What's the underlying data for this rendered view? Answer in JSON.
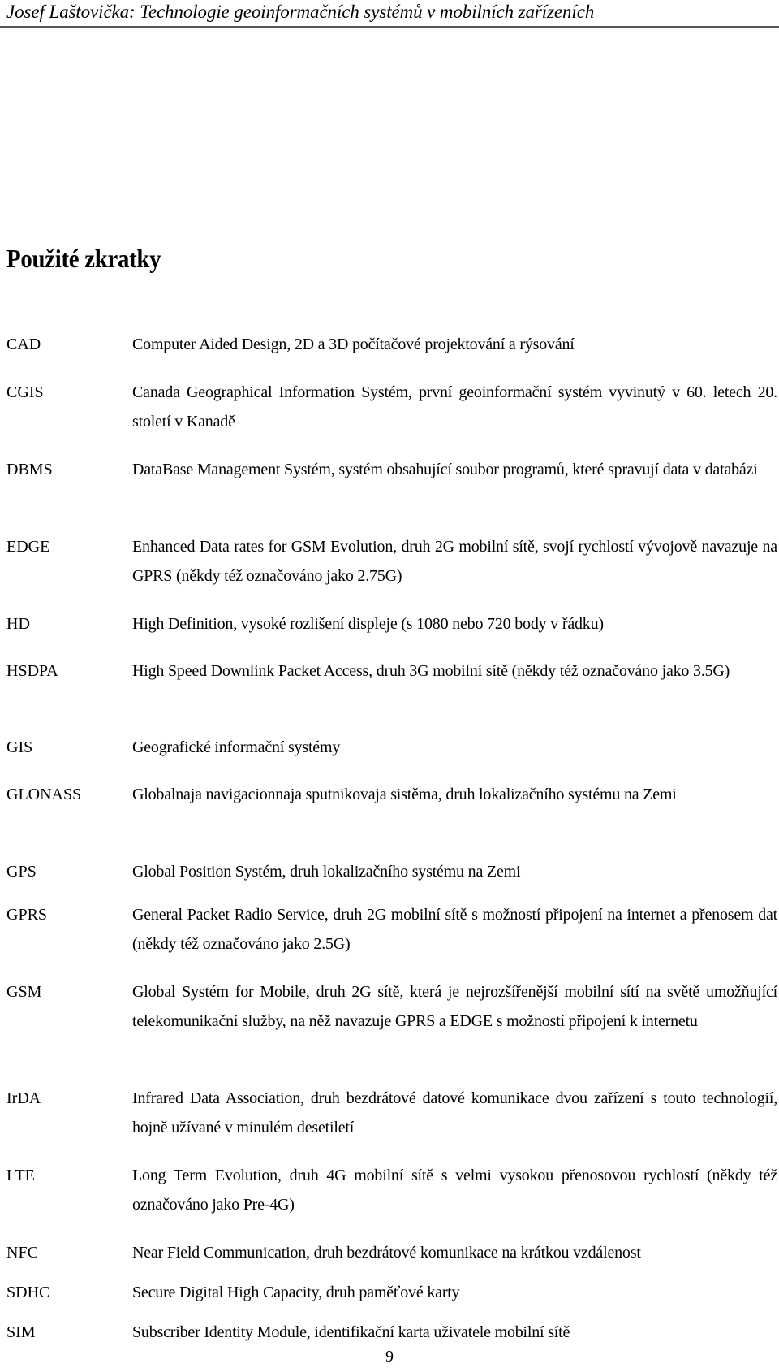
{
  "header": {
    "running_title": "Josef Laštovička: Technologie geoinformačních systémů v mobilních zařízeních"
  },
  "page_title": "Použité zkratky",
  "abbreviations": [
    {
      "term": "CAD",
      "definition": "Computer Aided Design, 2D a 3D počítačové projektování a rýsování"
    },
    {
      "term": "CGIS",
      "definition": "Canada Geographical Information Systém, první geoinformační systém vyvinutý v 60. letech 20. století v Kanadě"
    },
    {
      "term": "DBMS",
      "definition": "DataBase Management Systém, systém obsahující soubor programů, které spravují data v databázi"
    },
    {
      "term": "EDGE",
      "definition": "Enhanced Data rates for GSM Evolution, druh 2G mobilní sítě, svojí rychlostí vývojově navazuje na GPRS (někdy též označováno jako 2.75G)"
    },
    {
      "term": "HD",
      "definition": "High Definition, vysoké rozlišení displeje (s 1080 nebo 720 body v řádku)"
    },
    {
      "term": "HSDPA",
      "definition": "High Speed Downlink Packet Access, druh 3G mobilní sítě (někdy též označováno jako 3.5G)"
    },
    {
      "term": "GIS",
      "definition": "Geografické informační systémy"
    },
    {
      "term": "GLONASS",
      "definition": "Globalnaja navigacionnaja sputnikovaja sistěma, druh lokalizačního systému na Zemi"
    },
    {
      "term": "GPS",
      "definition": "Global Position Systém, druh lokalizačního systému na Zemi"
    },
    {
      "term": "GPRS",
      "definition": "General Packet Radio Service, druh 2G  mobilní sítě s možností připojení na internet a přenosem dat (někdy též označováno jako 2.5G)"
    },
    {
      "term": "GSM",
      "definition": "Global Systém for Mobile, druh 2G sítě, která je nejrozšířenější mobilní sítí na světě umožňující telekomunikační služby, na něž navazuje GPRS a EDGE s možností připojení k internetu"
    },
    {
      "term": "IrDA",
      "definition": "Infrared Data Association, druh bezdrátové datové komunikace dvou zařízení s touto technologií, hojně užívané v minulém desetiletí"
    },
    {
      "term": "LTE",
      "definition": "Long Term Evolution, druh 4G mobilní sítě s velmi vysokou přenosovou rychlostí (někdy též označováno jako Pre-4G)"
    },
    {
      "term": "NFC",
      "definition": "Near Field Communication, druh bezdrátové komunikace na krátkou vzdálenost"
    },
    {
      "term": "SDHC",
      "definition": "Secure Digital High Capacity, druh paměťové karty"
    },
    {
      "term": "SIM",
      "definition": "Subscriber Identity Module, identifikační karta uživatele mobilní sítě"
    }
  ],
  "footer": {
    "page_number": "9"
  }
}
